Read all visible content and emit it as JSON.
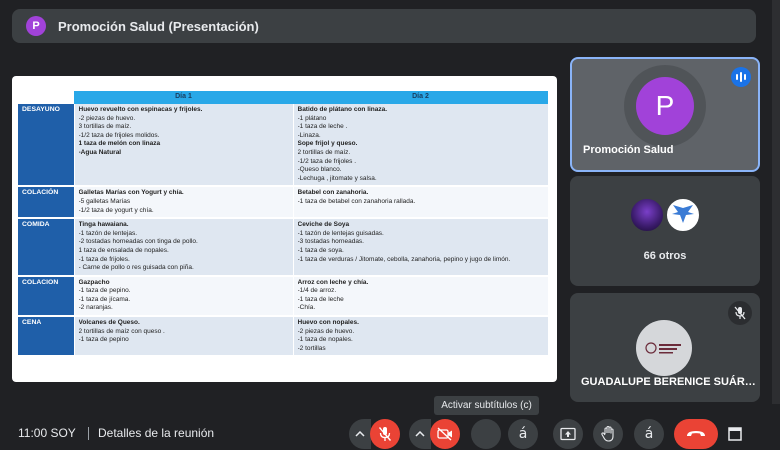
{
  "header": {
    "avatar_letter": "P",
    "title": "Promoción Salud (Presentación)"
  },
  "slide": {
    "columns": [
      "Día 1",
      "Día 2"
    ],
    "rows": [
      {
        "meal": "DESAYUNO",
        "day1": [
          {
            "t": "Huevo revuelto con espinacas y frijoles.",
            "b": true
          },
          {
            "t": "-2 piezas de huevo.",
            "b": false
          },
          {
            "t": " 3 tortillas de maíz.",
            "b": false
          },
          {
            "t": "-1/2 taza de frijoles molidos.",
            "b": false
          },
          {
            "t": "1 taza de melón con linaza",
            "b": true
          },
          {
            "t": "-Agua Natural",
            "b": true
          }
        ],
        "day2": [
          {
            "t": "Batido de plátano con linaza.",
            "b": true
          },
          {
            "t": "-1 plátano",
            "b": false
          },
          {
            "t": "-1 taza de leche .",
            "b": false
          },
          {
            "t": "-Linaza.",
            "b": false
          },
          {
            "t": "Sope  frijol y queso.",
            "b": true
          },
          {
            "t": " 2 tortillas de maíz.",
            "b": false
          },
          {
            "t": "-1/2 taza de frijoles .",
            "b": false
          },
          {
            "t": "-Queso blanco.",
            "b": false
          },
          {
            "t": "-Lechuga , jitomate y salsa.",
            "b": false
          }
        ]
      },
      {
        "meal": "COLACIÓN",
        "day1": [
          {
            "t": "Galletas Marías con Yogurt y chía.",
            "b": true
          },
          {
            "t": "-5 galletas Marías",
            "b": false
          },
          {
            "t": "-1/2 taza de yogurt y chía.",
            "b": false
          }
        ],
        "day2": [
          {
            "t": "Betabel con  zanahoria.",
            "b": true
          },
          {
            "t": "-1 taza de betabel con zanahoria rallada.",
            "b": false
          }
        ]
      },
      {
        "meal": "COMIDA",
        "day1": [
          {
            "t": "Tinga hawaiana.",
            "b": true
          },
          {
            "t": "-1 tazón de lentejas.",
            "b": false
          },
          {
            "t": "-2 tostadas horneadas con tinga de pollo.",
            "b": false
          },
          {
            "t": "  1 taza de ensalada de nopales.",
            "b": false
          },
          {
            "t": "-1 taza de frijoles.",
            "b": false
          },
          {
            "t": "- Carne de pollo o res  guisada con piña.",
            "b": false
          }
        ],
        "day2": [
          {
            "t": "Ceviche de Soya",
            "b": true
          },
          {
            "t": "-1 tazón de lentejas guisadas.",
            "b": false
          },
          {
            "t": "-3 tostadas horneadas.",
            "b": false
          },
          {
            "t": "-1 taza de soya.",
            "b": false
          },
          {
            "t": "-1 taza de verduras / Jitomate, cebolla, zanahoria, pepino y jugo de limón.",
            "b": false
          }
        ]
      },
      {
        "meal": "COLACION",
        "day1": [
          {
            "t": "Gazpacho",
            "b": true
          },
          {
            "t": "-1 taza de pepino.",
            "b": false
          },
          {
            "t": "-1 taza de jícama.",
            "b": false
          },
          {
            "t": "-2 naranjas.",
            "b": false
          }
        ],
        "day2": [
          {
            "t": "Arroz con leche  y chía.",
            "b": true
          },
          {
            "t": "-1/4 de arroz.",
            "b": false
          },
          {
            "t": "-1 taza de leche",
            "b": false
          },
          {
            "t": "-Chía.",
            "b": false
          }
        ]
      },
      {
        "meal": "CENA",
        "day1": [
          {
            "t": "Volcanes de Queso.",
            "b": true
          },
          {
            "t": " 2 tortillas de maíz con queso .",
            "b": false
          },
          {
            "t": "-1 taza de pepino",
            "b": false
          }
        ],
        "day2": [
          {
            "t": "Huevo con nopales.",
            "b": true
          },
          {
            "t": "-2 piezas de huevo.",
            "b": false
          },
          {
            "t": "-1 taza de nopales.",
            "b": false
          },
          {
            "t": "-2 tortillas",
            "b": false
          }
        ]
      }
    ]
  },
  "participants": {
    "presenter": {
      "letter": "P",
      "name": "Promoción Salud",
      "speaking_icon": "audio-bars-icon"
    },
    "group": {
      "count_label": "66 otros"
    },
    "third": {
      "name": "GUADALUPE BERENICE SUÁR…",
      "status_icon": "mic-off-icon"
    }
  },
  "tooltip": {
    "text": "Activar subtítulos (c)"
  },
  "bottom": {
    "time": "11:00 SOY",
    "details": "Detalles de la reunión",
    "caption_glyph_1": "á",
    "caption_glyph_2": "á"
  },
  "colors": {
    "accent": "#8ab4f8",
    "danger": "#ea4335",
    "avatar": "#a142d9",
    "table_header": "#29a8e8",
    "table_meal": "#1f5fa9"
  }
}
